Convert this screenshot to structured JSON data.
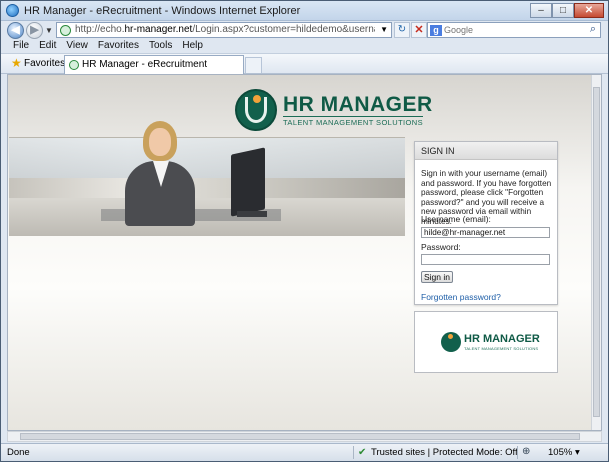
{
  "window": {
    "title": "HR Manager - eRecruitment - Windows Internet Explorer",
    "buttons": {
      "minimize": "–",
      "maximize": "□",
      "close": "✕"
    }
  },
  "address": {
    "url_prefix": "http://echo.",
    "url_domain": "hr-manager.net",
    "url_rest": "/Login.aspx?customer=hildedemo&username=hilde@hr-manager.net",
    "back_glyph": "◀",
    "forward_glyph": "▶",
    "refresh_glyph": "↻",
    "stop_glyph": "✕"
  },
  "search": {
    "engine_glyph": "g",
    "placeholder": "Google",
    "button_glyph": "⌕"
  },
  "menu": {
    "items": [
      "File",
      "Edit",
      "View",
      "Favorites",
      "Tools",
      "Help"
    ]
  },
  "favorites": {
    "label": "Favorites"
  },
  "tab": {
    "label": "HR Manager - eRecruitment"
  },
  "logo": {
    "name": "HR MANAGER",
    "tagline": "TALENT MANAGEMENT SOLUTIONS"
  },
  "signin": {
    "header": "SIGN IN",
    "message": "Sign in with your username (email) and password. If you have forgotten password, please click \"Forgotten password?\" and you will receive a new password via email within minutes.",
    "username_label": "Username (email):",
    "username_value": "hilde@hr-manager.net",
    "password_label": "Password:",
    "password_value": "",
    "button_label": "Sign in",
    "forgot_label": "Forgotten password?"
  },
  "status": {
    "left": "Done",
    "zone": "Trusted sites | Protected Mode: Off",
    "zoom": "105%",
    "zoom_drop": "▾"
  },
  "colors": {
    "brand_green": "#0f5a46",
    "accent_orange": "#f2a23a",
    "link_blue": "#1f5fa8"
  }
}
